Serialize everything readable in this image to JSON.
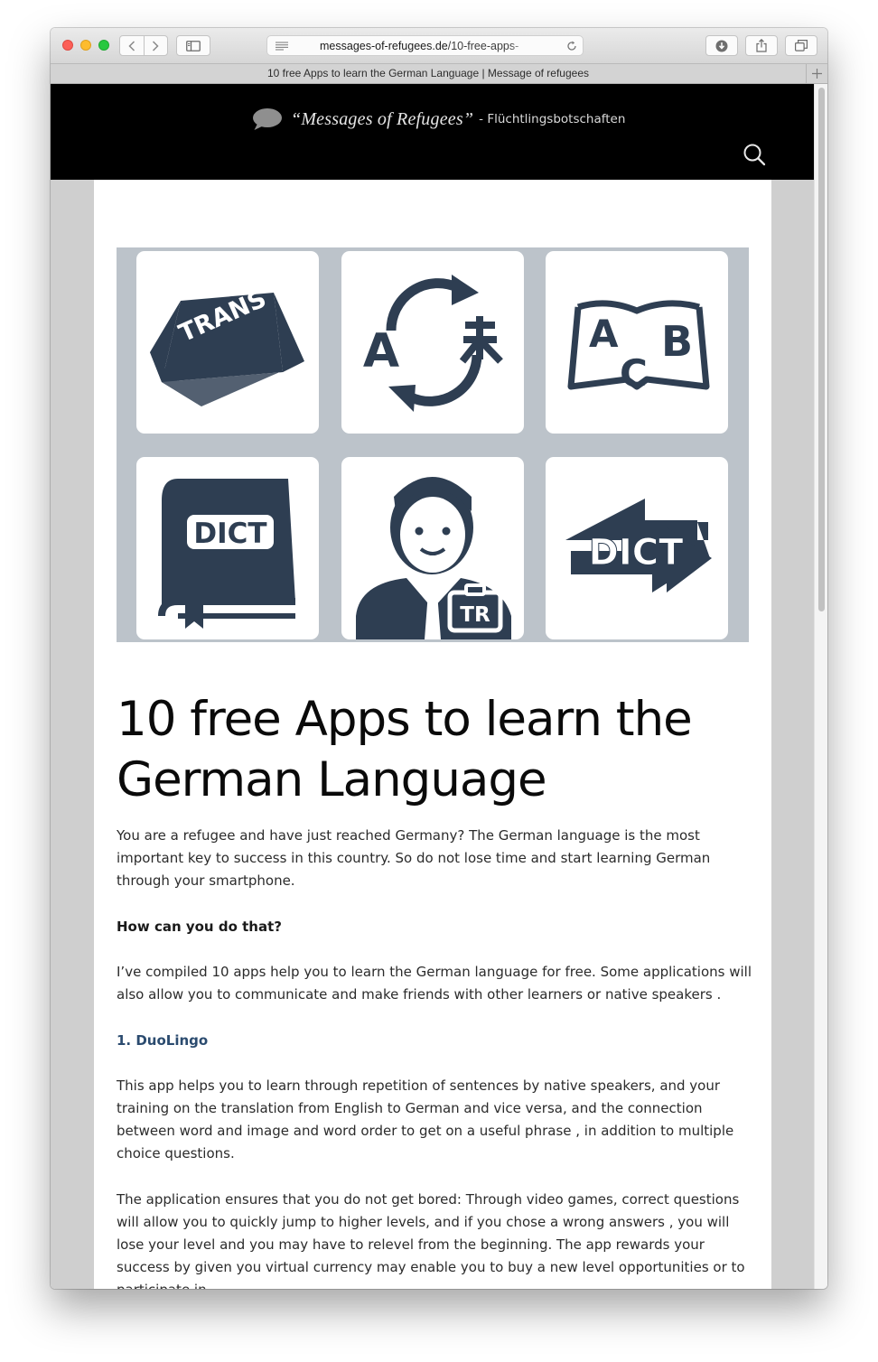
{
  "browser": {
    "url_domain": "messages-of-refugees.de",
    "url_path": "/10-free-apps-",
    "tab_title": "10 free Apps to learn the German Language | Message of refugees",
    "icons": [
      "back-icon",
      "forward-icon",
      "sidebar-icon",
      "reader-icon",
      "reload-icon",
      "download-icon",
      "share-icon",
      "tabs-icon",
      "plus-icon"
    ]
  },
  "site": {
    "name_italic": "“Messages of Refugees”",
    "name_rest": " - Flüchtlingsbotschaften"
  },
  "hero": {
    "tile_texts": [
      "TRANS",
      "A",
      "ABC",
      "DICT",
      "TR",
      "DICT"
    ],
    "icon_color": "#2e3e52",
    "background": "#bcc3ca"
  },
  "article": {
    "title": "10 free Apps to learn the German Language",
    "intro": "You are a refugee and have just reached Germany? The German language is the most important key to success in this country. So do not lose time and start learning German through your smartphone.",
    "subheading": "How can you do that?",
    "paragraph2": "I’ve compiled 10 apps help you to learn the German language for free. Some applications will also allow you to communicate and make friends with other learners or native speakers .",
    "section1_heading": "1. DuoLingo",
    "paragraph3": "This app helps you to learn through repetition of sentences by native speakers, and your training on the translation from English to German and vice versa, and the connection between word and image and word order to get on a useful phrase , in addition to multiple choice questions.",
    "paragraph4": "The application ensures that you do not get bored: Through video games, correct questions will allow you to quickly jump to higher levels, and if you chose a wrong answers , you will lose your level and you may have to relevel from the beginning. The app rewards your success by given you virtual currency may enable you to buy a new level opportunities or to participate in"
  },
  "colors": {
    "header_bg": "#000000",
    "link": "#2b4b6f",
    "page_bg": "#cfcfcf"
  }
}
